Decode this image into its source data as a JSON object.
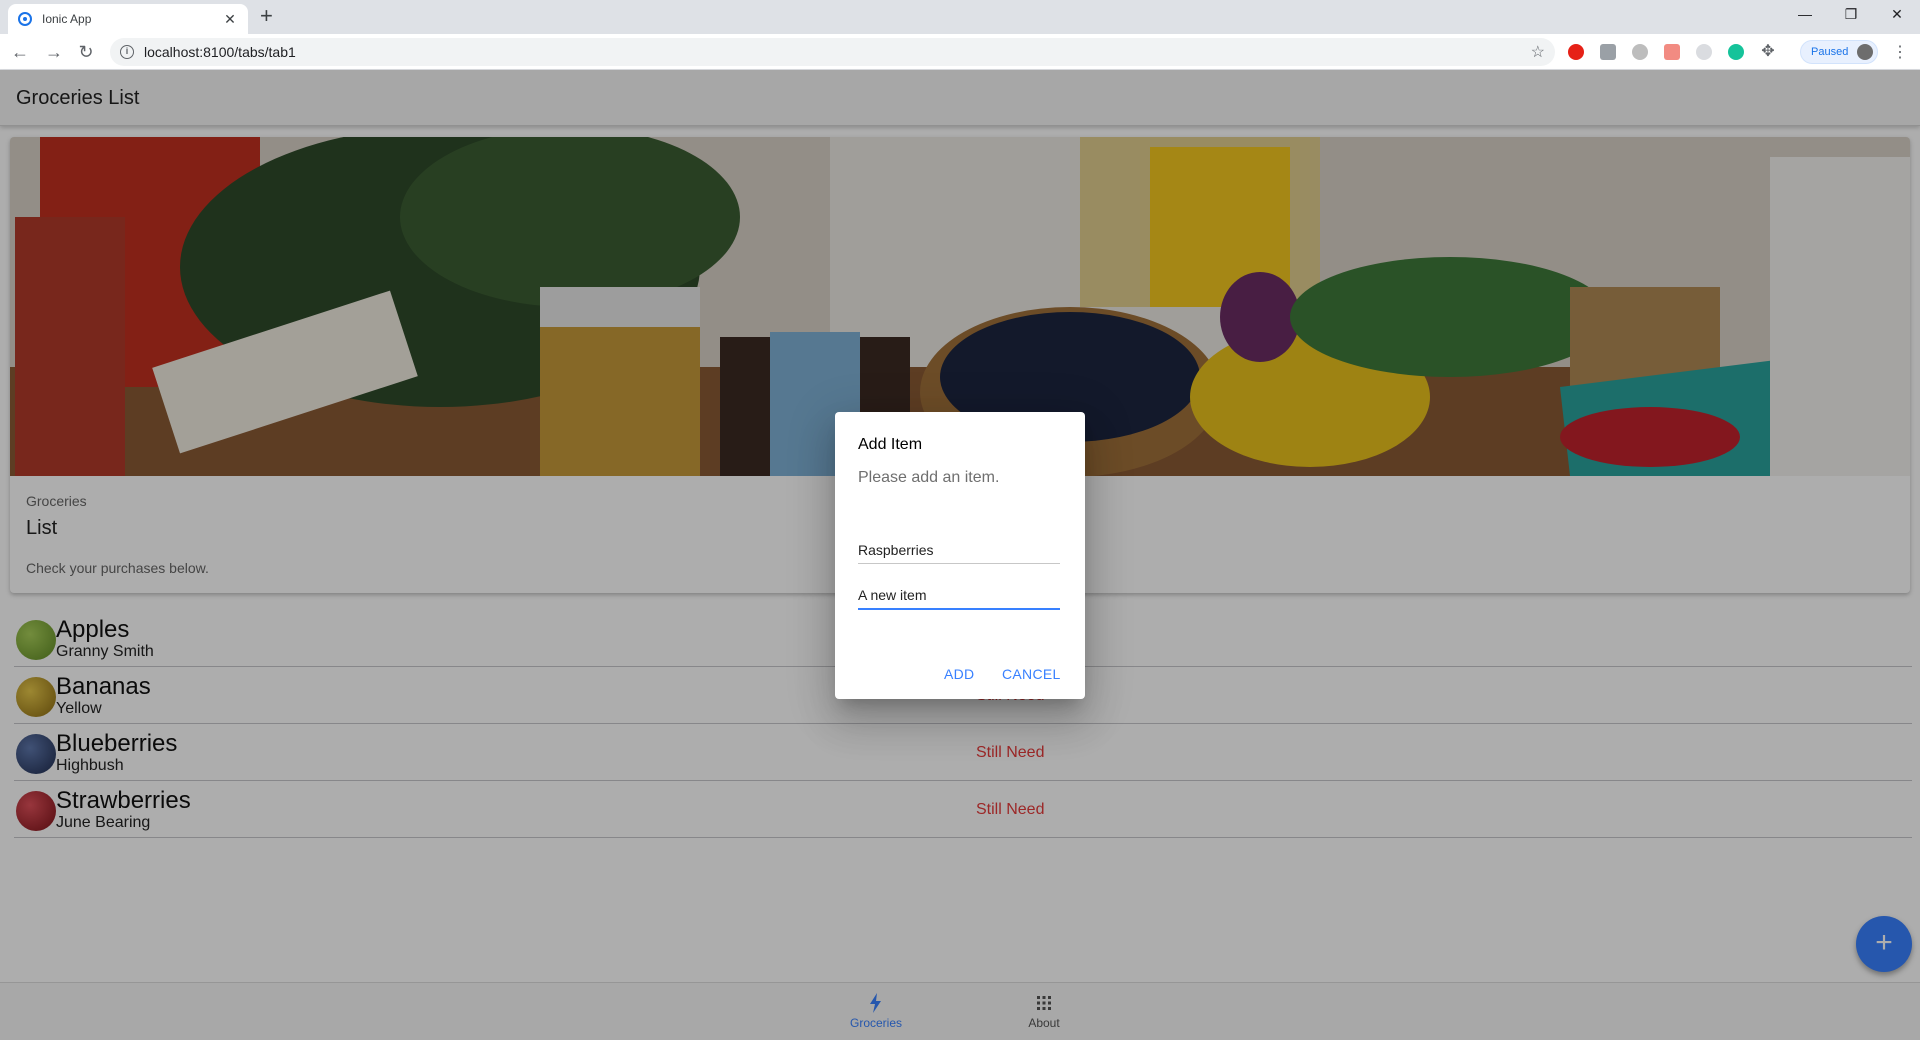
{
  "browser": {
    "tab_title": "Ionic App",
    "tab_close": "✕",
    "new_tab": "+",
    "url": "localhost:8100/tabs/tab1",
    "profile_status": "Paused",
    "window_controls": {
      "minimize": "—",
      "restore": "❐",
      "close": "✕"
    }
  },
  "header": {
    "title": "Groceries List"
  },
  "card": {
    "image_alt": "Groceries photo",
    "subtitle": "Groceries",
    "title": "List",
    "content": "Check your purchases below."
  },
  "items": [
    {
      "name": "Apples",
      "note": "Granny Smith",
      "status": "",
      "avatar_color": "#7aa33a"
    },
    {
      "name": "Bananas",
      "note": "Yellow",
      "status": "Still Need",
      "avatar_color": "#c9a52a"
    },
    {
      "name": "Blueberries",
      "note": "Highbush",
      "status": "Still Need",
      "avatar_color": "#3a4f80"
    },
    {
      "name": "Strawberries",
      "note": "June Bearing",
      "status": "Still Need",
      "avatar_color": "#b52d35"
    }
  ],
  "dialog": {
    "title": "Add Item",
    "message": "Please add an item.",
    "inputs": [
      {
        "placeholder": "Raspberries",
        "value": ""
      },
      {
        "placeholder": "A new item",
        "value": ""
      }
    ],
    "buttons": {
      "add": "ADD",
      "cancel": "CANCEL"
    }
  },
  "tabs": [
    {
      "label": "Groceries",
      "icon": "flash-icon",
      "selected": true
    },
    {
      "label": "About",
      "icon": "apps-icon",
      "selected": false
    }
  ],
  "fab": {
    "icon": "add-icon",
    "label": "+"
  },
  "colors": {
    "primary": "#3880ff",
    "danger": "#e63b3b",
    "header_bg": "#f7f7f7",
    "backdrop": "rgba(0,0,0,0.32)"
  }
}
